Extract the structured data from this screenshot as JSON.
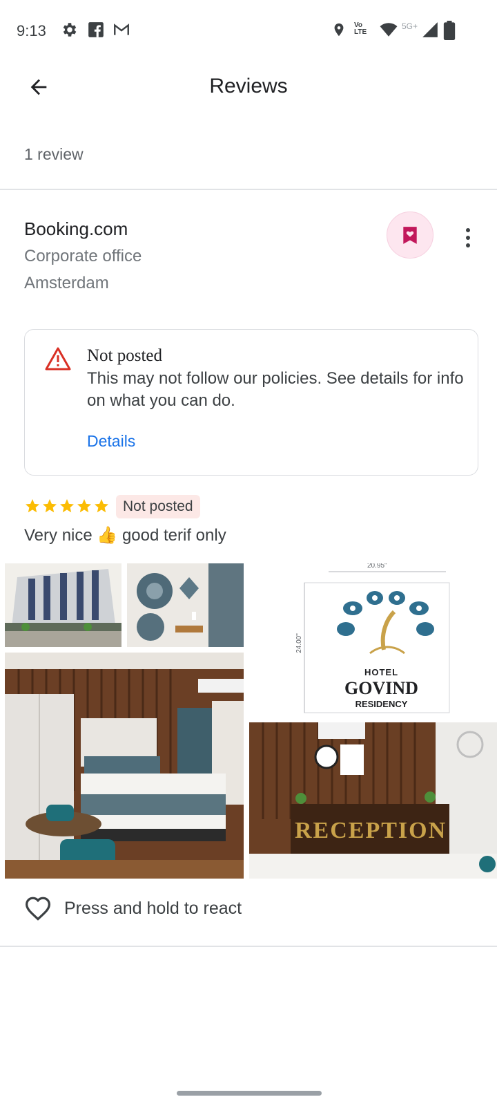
{
  "status_bar": {
    "time": "9:13",
    "left_icons": [
      "settings-icon",
      "facebook-icon",
      "gmail-icon"
    ],
    "right_icons": [
      "location-icon",
      "volte-icon",
      "wifi-icon",
      "signal-icon",
      "battery-icon"
    ],
    "volte_label": "Vo LTE",
    "network_label": "5G+"
  },
  "app_bar": {
    "title": "Reviews",
    "back_icon": "arrow-back-icon"
  },
  "review_count": "1 review",
  "place": {
    "name": "Booking.com",
    "category": "Corporate office",
    "location": "Amsterdam",
    "save_icon": "bookmark-heart-icon",
    "more_icon": "more-vert-icon"
  },
  "notice": {
    "icon": "warning-icon",
    "title": "Not posted",
    "body": "This may not follow our policies. See details for info on what you can do.",
    "link": "Details"
  },
  "review": {
    "rating": 5,
    "max_rating": 5,
    "status_badge": "Not posted",
    "text": "Very nice 👍 good terif only"
  },
  "photos": {
    "logo_hotel": "HOTEL",
    "logo_name": "GOVIND",
    "logo_residency": "RESIDENCY",
    "logo_width_dim": "20.95\"",
    "logo_height_dim": "24.00\"",
    "reception_sign": "RECEPTION"
  },
  "reaction": {
    "icon": "heart-outline-icon",
    "label": "Press and hold to react"
  },
  "colors": {
    "accent_pink": "#c2185b",
    "star": "#fbbc04",
    "link_blue": "#1a73e8",
    "warning_red": "#d93025",
    "badge_bg": "#fce8e6"
  }
}
